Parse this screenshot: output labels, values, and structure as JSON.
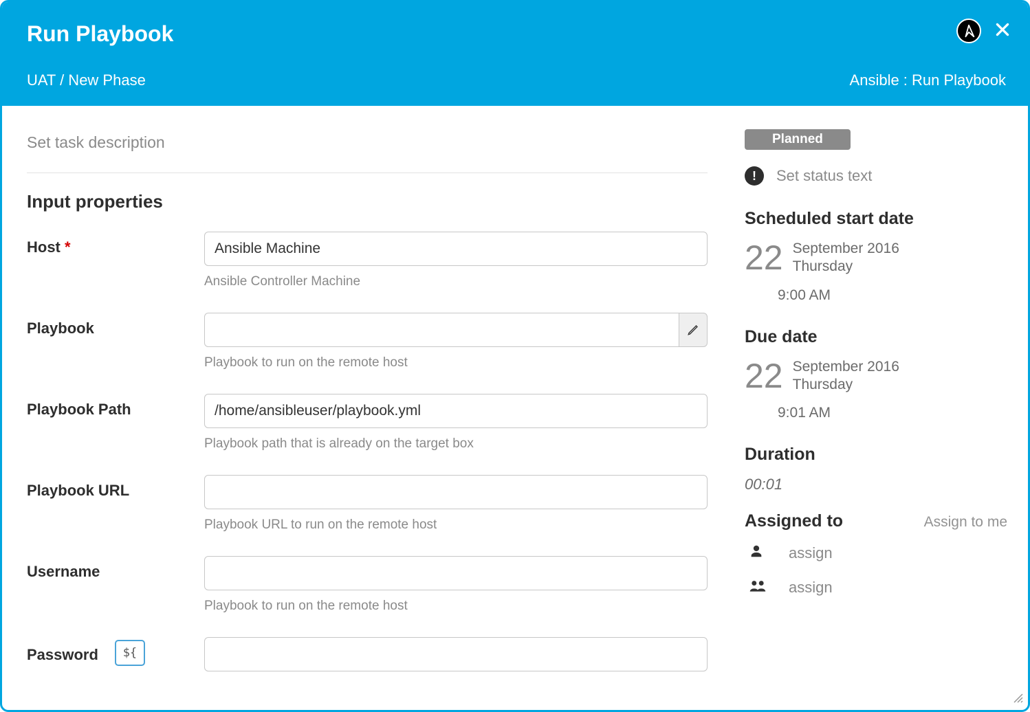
{
  "header": {
    "title": "Run Playbook",
    "breadcrumb": "UAT / New Phase",
    "type_label": "Ansible : Run Playbook",
    "logo_letter": "A"
  },
  "main": {
    "description_placeholder": "Set task description",
    "section_title": "Input properties",
    "fields": {
      "host": {
        "label": "Host",
        "required_mark": "*",
        "value": "Ansible Machine",
        "help": "Ansible Controller Machine"
      },
      "playbook": {
        "label": "Playbook",
        "value": "",
        "help": "Playbook to run on the remote host"
      },
      "playbook_path": {
        "label": "Playbook Path",
        "value": "/home/ansibleuser/playbook.yml",
        "help": "Playbook path that is already on the target box"
      },
      "playbook_url": {
        "label": "Playbook URL",
        "value": "",
        "help": "Playbook URL to run on the remote host"
      },
      "username": {
        "label": "Username",
        "value": "",
        "help": "Playbook to run on the remote host"
      },
      "password": {
        "label": "Password",
        "var_btn": "${",
        "value": ""
      }
    }
  },
  "sidebar": {
    "status_badge": "Planned",
    "status_text_placeholder": "Set status text",
    "scheduled_heading": "Scheduled start date",
    "scheduled": {
      "day": "22",
      "month_year": "September 2016",
      "weekday": "Thursday",
      "time": "9:00 AM"
    },
    "due_heading": "Due date",
    "due": {
      "day": "22",
      "month_year": "September 2016",
      "weekday": "Thursday",
      "time": "9:01 AM"
    },
    "duration_heading": "Duration",
    "duration_value": "00:01",
    "assigned_heading": "Assigned to",
    "assign_to_me": "Assign to me",
    "assign_person": "assign",
    "assign_team": "assign"
  }
}
